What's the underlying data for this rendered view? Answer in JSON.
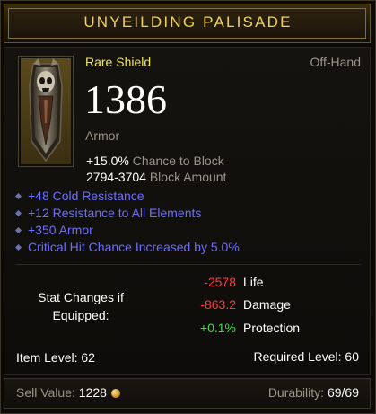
{
  "item": {
    "name": "UNYEILDING PALISADE",
    "rarity": "Rare Shield",
    "slot": "Off-Hand",
    "icon": "skull-shield-icon",
    "armor_value": "1386",
    "armor_label": "Armor"
  },
  "base_stats": [
    {
      "value": "+15.0%",
      "label": "Chance to Block"
    },
    {
      "value": "2794-3704",
      "label": "Block Amount"
    }
  ],
  "affixes": [
    "+48 Cold Resistance",
    "+12 Resistance to All Elements",
    "+350 Armor",
    "Critical Hit Chance Increased by 5.0%"
  ],
  "stat_changes": {
    "title_line1": "Stat Changes if",
    "title_line2": "Equipped:",
    "rows": [
      {
        "value": "-2578",
        "label": "Life",
        "color": "#ff3a3a"
      },
      {
        "value": "-863.2",
        "label": "Damage",
        "color": "#ff3a3a"
      },
      {
        "value": "+0.1%",
        "label": "Protection",
        "color": "#3fe03f"
      }
    ]
  },
  "levels": {
    "item_level": "Item Level: 62",
    "required_level": "Required Level: 60"
  },
  "footer": {
    "sell_label": "Sell Value:",
    "sell_value": "1228",
    "durability_label": "Durability:",
    "durability_value": "69/69"
  },
  "colors": {
    "title": "#f1d35a",
    "rare": "#f2e65c",
    "magic_affix": "#6d6dff",
    "negative": "#ff3a3a",
    "positive": "#3fe03f"
  }
}
